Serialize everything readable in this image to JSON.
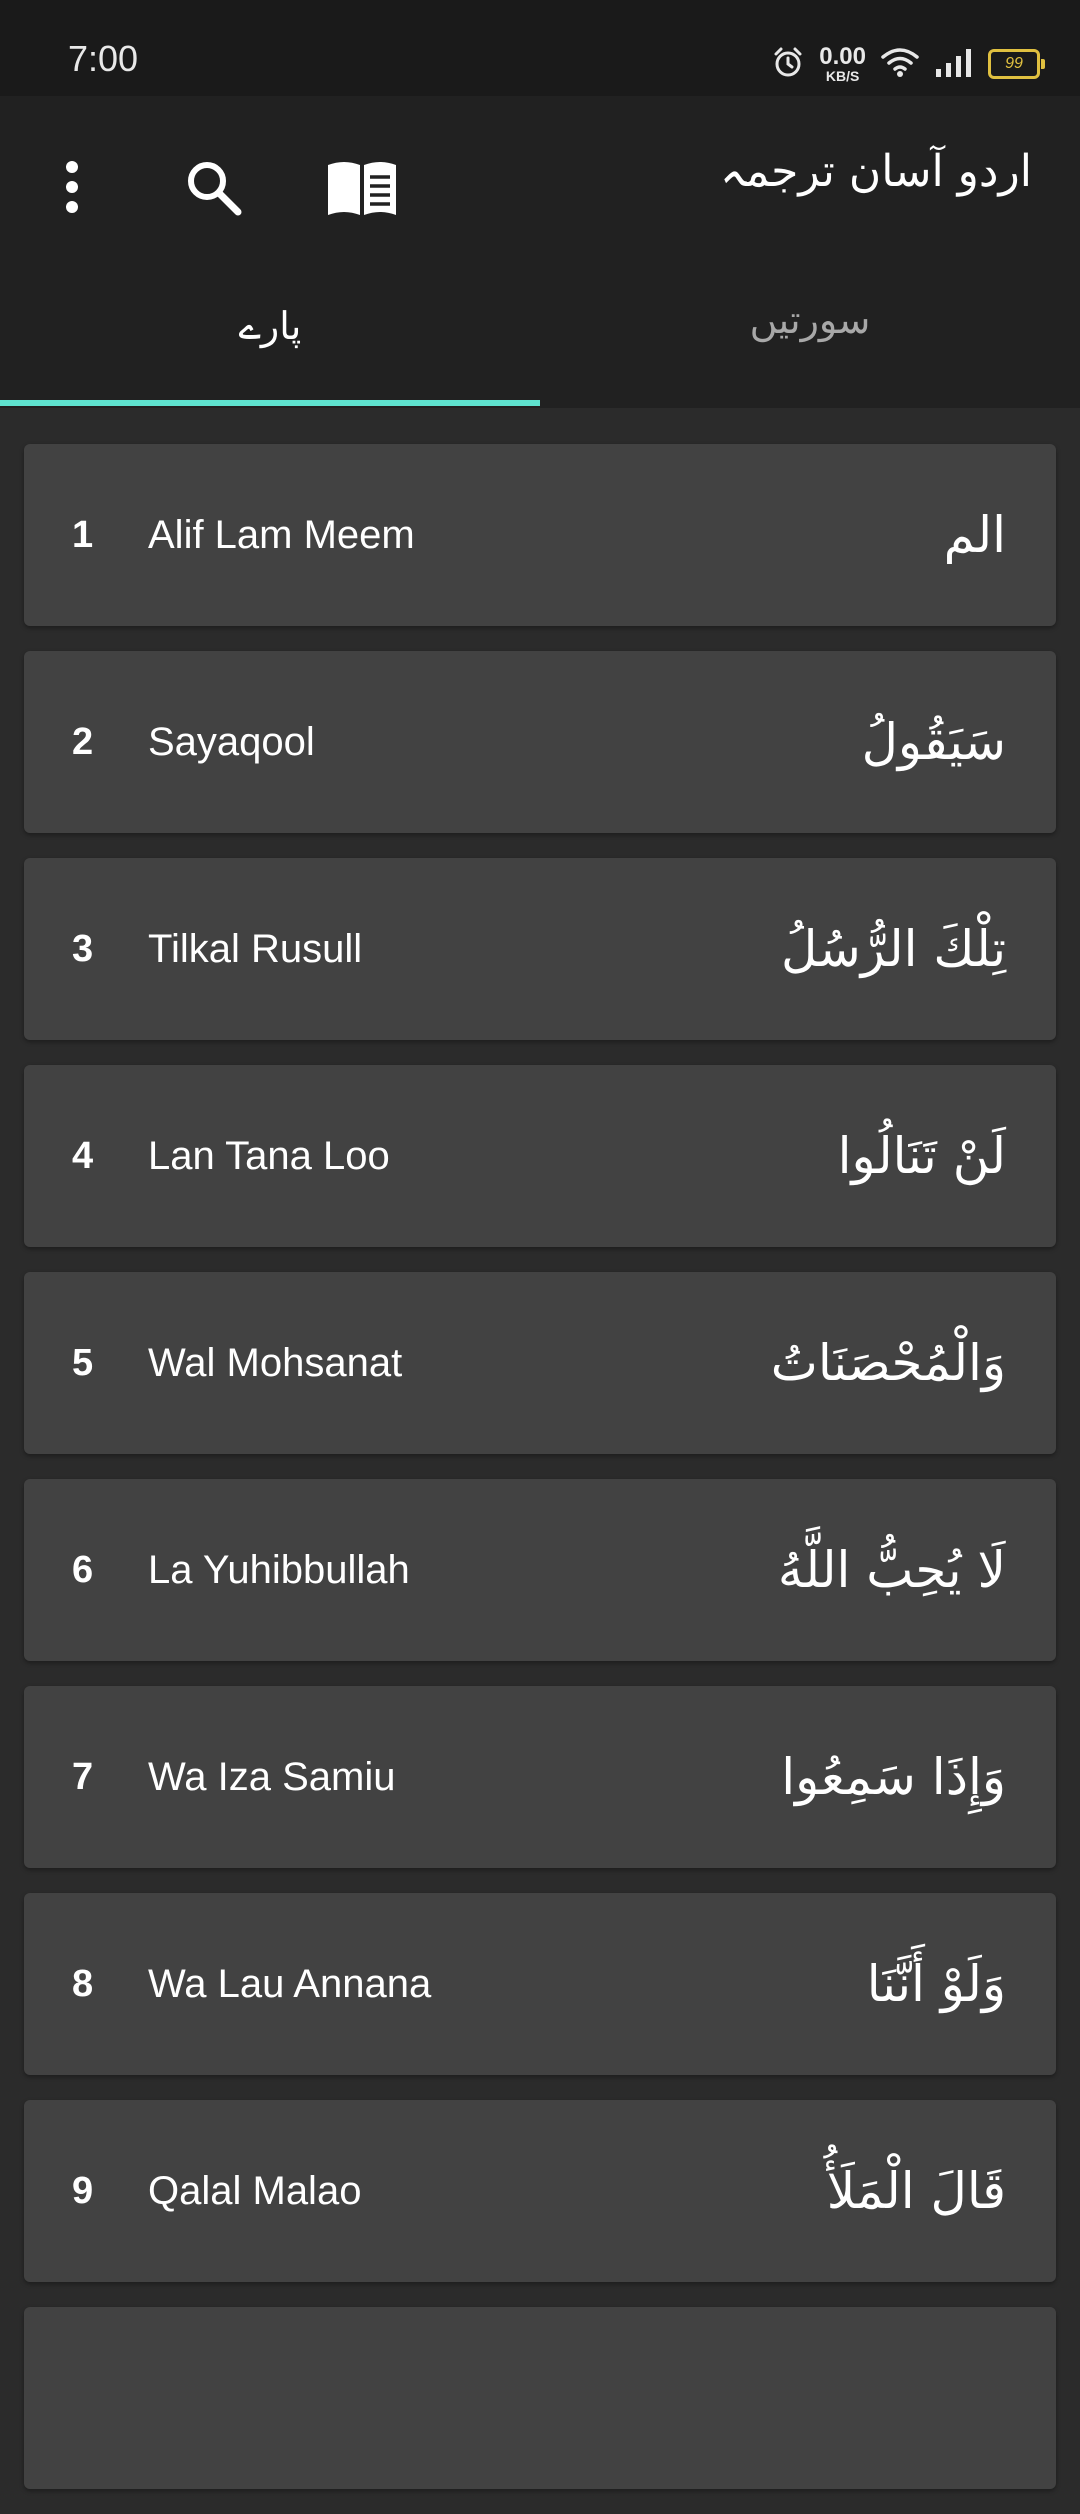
{
  "status": {
    "time": "7:00",
    "net_speed": "0.00",
    "net_unit": "KB/S",
    "battery": "99",
    "icons": [
      "alarm-icon",
      "wifi-icon",
      "signal-icon",
      "battery-icon"
    ]
  },
  "toolbar": {
    "title": "اردو آسان ترجمہ",
    "icons": [
      "more-vert-icon",
      "search-icon",
      "book-icon"
    ]
  },
  "tabs": [
    {
      "label": "پارے",
      "selected": true
    },
    {
      "label": "سورتیں",
      "selected": false
    }
  ],
  "accent_color": "#5fe3cf",
  "paras": [
    {
      "number": "1",
      "name": "Alif Lam Meem",
      "arabic": "الم"
    },
    {
      "number": "2",
      "name": "Sayaqool",
      "arabic": "سَيَقُولُ"
    },
    {
      "number": "3",
      "name": "Tilkal Rusull",
      "arabic": "تِلْكَ الرُّسُلُ"
    },
    {
      "number": "4",
      "name": "Lan Tana Loo",
      "arabic": "لَنْ تَنَالُوا"
    },
    {
      "number": "5",
      "name": "Wal Mohsanat",
      "arabic": "وَالْمُحْصَنَاتُ"
    },
    {
      "number": "6",
      "name": "La Yuhibbullah",
      "arabic": "لَا يُحِبُّ اللَّهُ"
    },
    {
      "number": "7",
      "name": "Wa Iza Samiu",
      "arabic": "وَإِذَا سَمِعُوا"
    },
    {
      "number": "8",
      "name": "Wa Lau Annana",
      "arabic": "وَلَوْ أَنَّنَا"
    },
    {
      "number": "9",
      "name": "Qalal Malao",
      "arabic": "قَالَ الْمَلَأُ"
    }
  ]
}
